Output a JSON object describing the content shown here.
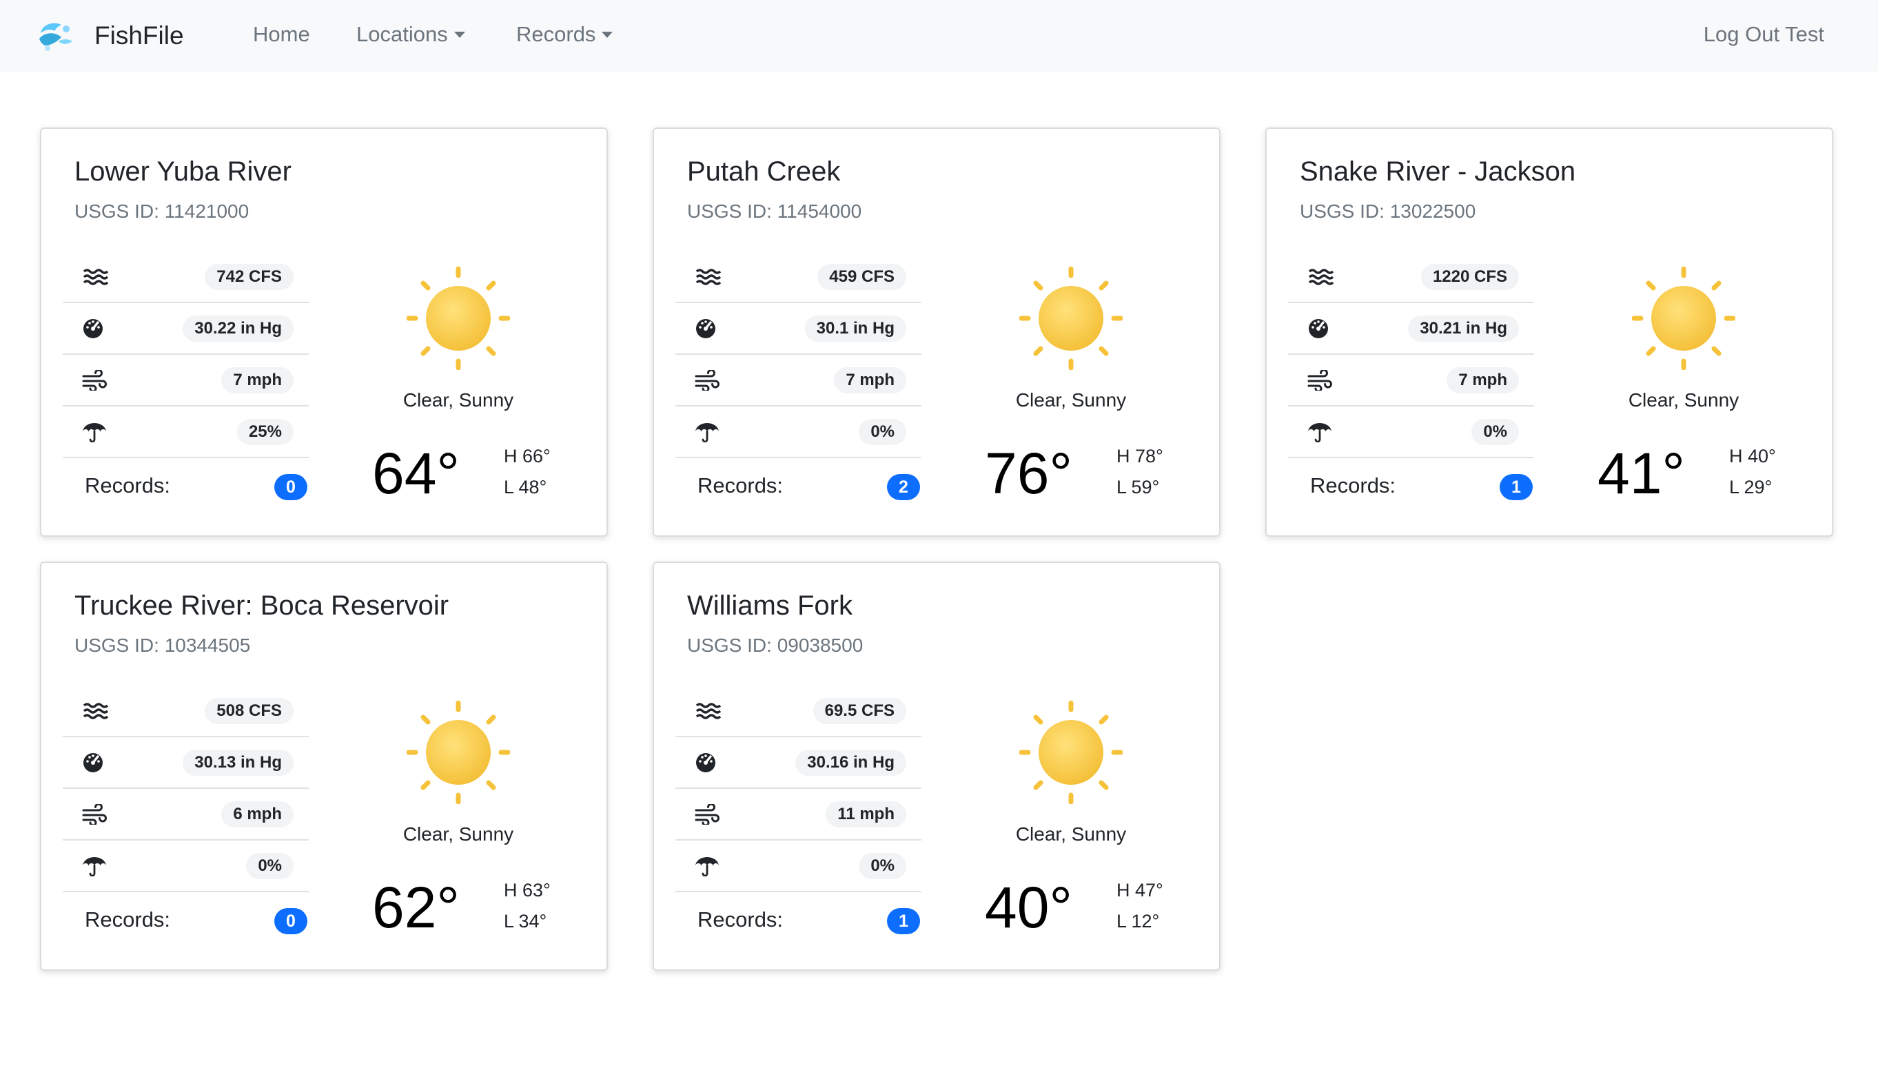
{
  "navbar": {
    "brand": "FishFile",
    "home_label": "Home",
    "locations_label": "Locations",
    "records_label": "Records",
    "logout_label": "Log Out Test"
  },
  "locations": [
    {
      "name": "Lower Yuba River",
      "usgs": "USGS ID: 11421000",
      "flow": "742 CFS",
      "pressure": "30.22 in Hg",
      "wind": "7 mph",
      "precip": "25%",
      "records_label": "Records:",
      "records": "0",
      "condition": "Clear, Sunny",
      "temp": "64°",
      "high": "H 66°",
      "low": "L 48°"
    },
    {
      "name": "Putah Creek",
      "usgs": "USGS ID: 11454000",
      "flow": "459 CFS",
      "pressure": "30.1 in Hg",
      "wind": "7 mph",
      "precip": "0%",
      "records_label": "Records:",
      "records": "2",
      "condition": "Clear, Sunny",
      "temp": "76°",
      "high": "H 78°",
      "low": "L 59°"
    },
    {
      "name": "Snake River - Jackson",
      "usgs": "USGS ID: 13022500",
      "flow": "1220 CFS",
      "pressure": "30.21 in Hg",
      "wind": "7 mph",
      "precip": "0%",
      "records_label": "Records:",
      "records": "1",
      "condition": "Clear, Sunny",
      "temp": "41°",
      "high": "H 40°",
      "low": "L 29°"
    },
    {
      "name": "Truckee River: Boca Reservoir",
      "usgs": "USGS ID: 10344505",
      "flow": "508 CFS",
      "pressure": "30.13 in Hg",
      "wind": "6 mph",
      "precip": "0%",
      "records_label": "Records:",
      "records": "0",
      "condition": "Clear, Sunny",
      "temp": "62°",
      "high": "H 63°",
      "low": "L 34°"
    },
    {
      "name": "Williams Fork",
      "usgs": "USGS ID: 09038500",
      "flow": "69.5 CFS",
      "pressure": "30.16 in Hg",
      "wind": "11 mph",
      "precip": "0%",
      "records_label": "Records:",
      "records": "1",
      "condition": "Clear, Sunny",
      "temp": "40°",
      "high": "H 47°",
      "low": "L 12°"
    }
  ],
  "icons": {
    "logo": "fish-logo-icon",
    "flow": "water-waves-icon",
    "pressure": "gauge-icon",
    "wind": "wind-icon",
    "precip": "umbrella-icon",
    "weather": "sun-icon"
  },
  "colors": {
    "badge": "#0d6efd",
    "sun": "#f7c83a",
    "navbar_bg": "#f8f9fa"
  }
}
